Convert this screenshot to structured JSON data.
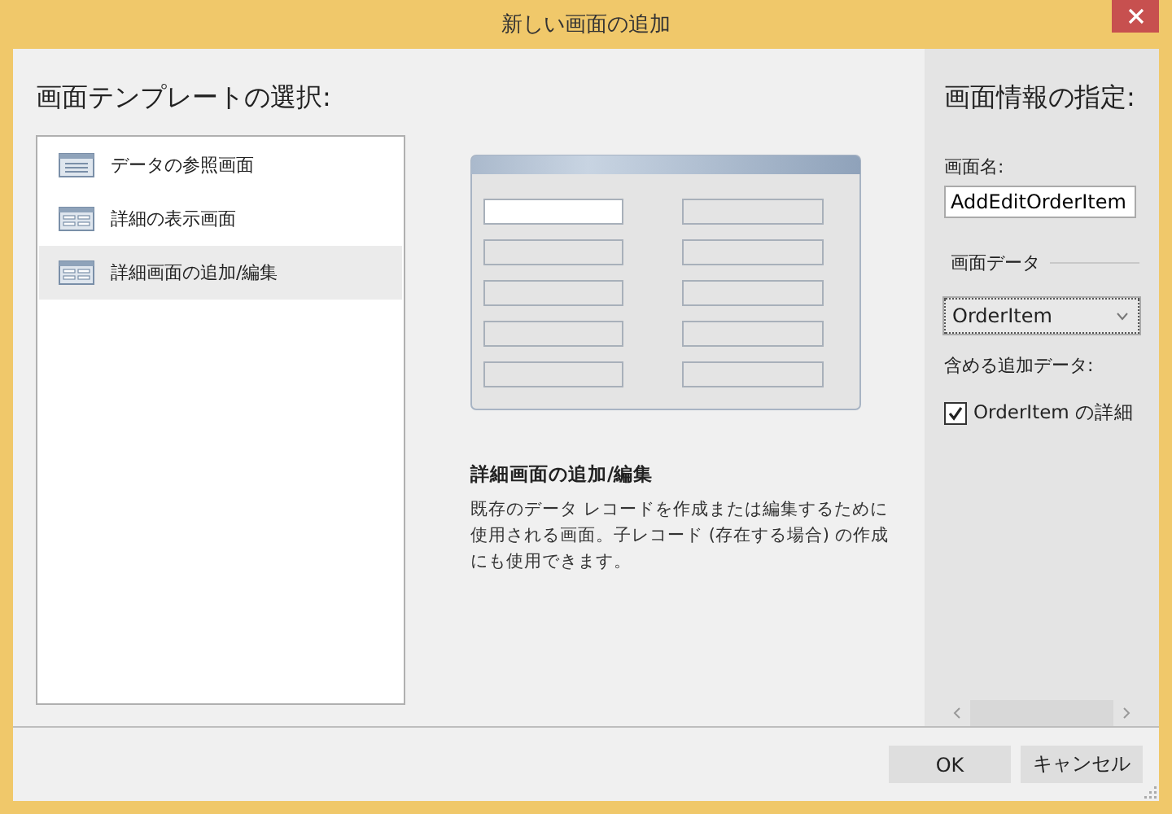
{
  "window": {
    "title": "新しい画面の追加"
  },
  "templates": {
    "heading": "画面テンプレートの選択:",
    "items": [
      {
        "label": "データの参照画面",
        "kind": "list",
        "selected": false
      },
      {
        "label": "詳細の表示画面",
        "kind": "details",
        "selected": false
      },
      {
        "label": "詳細画面の追加/編集",
        "kind": "details",
        "selected": true
      }
    ]
  },
  "preview": {
    "title": "詳細画面の追加/編集",
    "description": "既存のデータ レコードを作成または編集するために使用される画面。子レコード (存在する場合) の作成にも使用できます。"
  },
  "screen_info": {
    "heading": "画面情報の指定:",
    "name_label": "画面名:",
    "name_value": "AddEditOrderItem",
    "data_group": "画面データ",
    "data_value": "OrderItem",
    "extra_label": "含める追加データ:",
    "extras": [
      {
        "label": "OrderItem の詳細",
        "checked": true
      }
    ]
  },
  "buttons": [
    "OK",
    "キャンセル"
  ]
}
